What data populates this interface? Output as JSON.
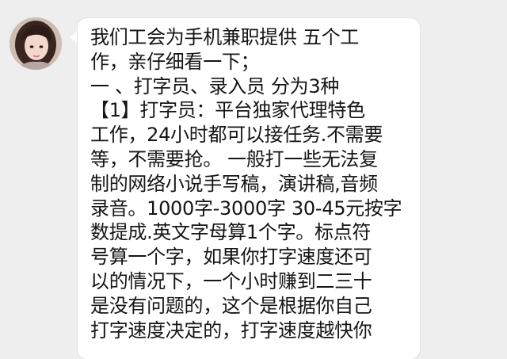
{
  "chat": {
    "sender_avatar_icon": "user-avatar-photo",
    "bubble_color": "#ffffff",
    "background_color": "#eeeeee",
    "message_lines": [
      "我们工会为手机兼职提供 五个工",
      "作，亲仔细看一下；",
      "一 、打字员、录入员  分为3种",
      "【1】打字员：平台独家代理特色",
      "工作，24小时都可以接任务.不需要",
      "等，不需要抢。 一般打一些无法复",
      "制的网络小说手写稿，演讲稿,音频",
      "录音。1000字-3000字 30-45元按字",
      "数提成.英文字母算1个字。标点符",
      "号算一个字，如果你打字速度还可",
      "以的情况下，一个小时赚到二三十",
      "是没有问题的，这个是根据你自己",
      "打字速度决定的，打字速度越快你"
    ]
  }
}
